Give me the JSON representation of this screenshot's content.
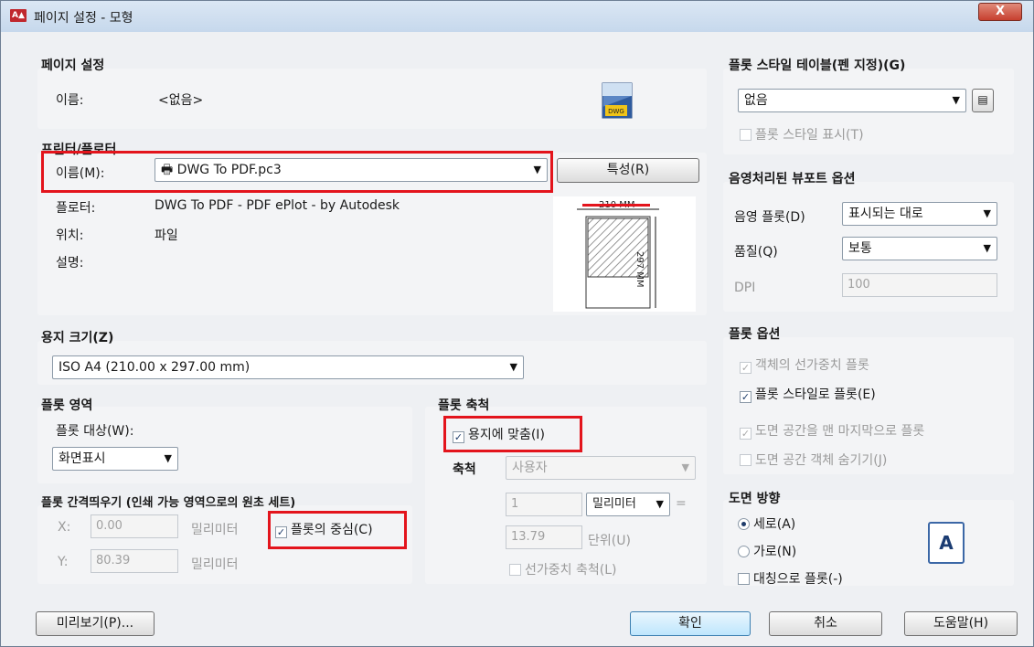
{
  "window": {
    "title": "페이지 설정 - 모형",
    "app_icon": "A▲",
    "close_label": "X"
  },
  "page_setup": {
    "section_title": "페이지 설정",
    "name_label": "이름:",
    "name_value": "<없음>"
  },
  "printer": {
    "section_title": "프린터/플로터",
    "name_label": "이름(M):",
    "name_value": "DWG To PDF.pc3",
    "properties_button": "특성(R)",
    "plotter_label": "플로터:",
    "plotter_value": "DWG To PDF - PDF ePlot - by Autodesk",
    "location_label": "위치:",
    "location_value": "파일",
    "description_label": "설명:",
    "preview_width_text": "210 MM",
    "preview_height_text": "297 MM"
  },
  "paper_size": {
    "section_title": "용지 크기(Z)",
    "value": "ISO A4 (210.00 x 297.00 mm)"
  },
  "plot_area": {
    "section_title": "플롯 영역",
    "what_label": "플롯 대상(W):",
    "what_value": "화면표시"
  },
  "plot_offset": {
    "section_title": "플롯 간격띄우기 (인쇄 가능 영역으로의 원초 세트)",
    "x_label": "X:",
    "x_value": "0.00",
    "x_unit": "밀리미터",
    "y_label": "Y:",
    "y_value": "80.39",
    "y_unit": "밀리미터",
    "center_label": "플롯의 중심(C)",
    "center_checked": true
  },
  "plot_scale": {
    "section_title": "플롯 축척",
    "fit_label": "용지에 맞춤(I)",
    "fit_checked": true,
    "scale_label": "축척",
    "scale_value": "사용자",
    "value1": "1",
    "unit_value": "밀리미터",
    "equals": "=",
    "value2": "13.79",
    "unit2": "단위(U)",
    "lineweight_label": "선가중치 축척(L)",
    "lineweight_checked": false
  },
  "plot_style": {
    "section_title": "플롯 스타일 테이블(펜 지정)(G)",
    "value": "없음",
    "display_label": "플롯 스타일 표시(T)",
    "display_checked": false
  },
  "shaded": {
    "section_title": "음영처리된 뷰포트 옵션",
    "plot_label": "음영 플롯(D)",
    "plot_value": "표시되는 대로",
    "quality_label": "품질(Q)",
    "quality_value": "보통",
    "dpi_label": "DPI",
    "dpi_value": "100"
  },
  "plot_options": {
    "section_title": "플롯 옵션",
    "items": [
      {
        "label": "객체의 선가중치 플롯",
        "checked": true,
        "enabled": false
      },
      {
        "label": "플롯 스타일로 플롯(E)",
        "checked": true,
        "enabled": true
      },
      {
        "label": "도면 공간을 맨 마지막으로 플롯",
        "checked": true,
        "enabled": false
      },
      {
        "label": "도면 공간 객체 숨기기(J)",
        "checked": false,
        "enabled": false
      }
    ]
  },
  "orientation": {
    "section_title": "도면 방향",
    "portrait_label": "세로(A)",
    "portrait_selected": true,
    "landscape_label": "가로(N)",
    "landscape_selected": false,
    "upside_down_label": "대칭으로 플롯(-)",
    "upside_down_checked": false,
    "icon_letter": "A"
  },
  "buttons": {
    "preview": "미리보기(P)...",
    "ok": "확인",
    "cancel": "취소",
    "help": "도움말(H)"
  }
}
